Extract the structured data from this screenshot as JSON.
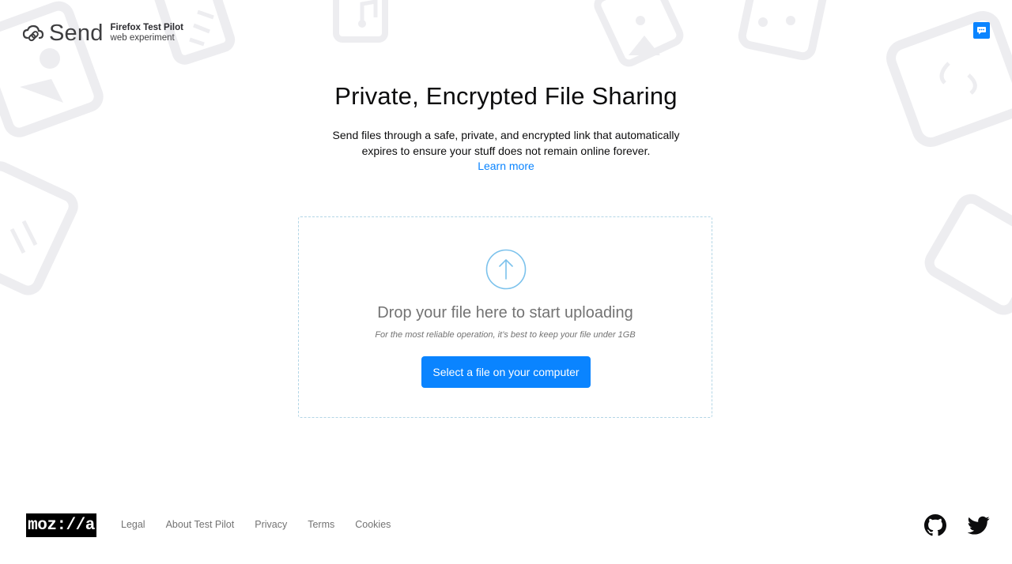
{
  "header": {
    "brand_name": "Send",
    "test_pilot_label": "Firefox Test Pilot",
    "experiment_label": "web experiment",
    "feedback_icon": "chat-bubble-icon"
  },
  "hero": {
    "title": "Private, Encrypted File Sharing",
    "description": "Send files through a safe, private, and encrypted link that automatically expires to ensure your stuff does not remain online forever.",
    "learn_more": "Learn more"
  },
  "upload": {
    "icon": "upload-arrow-icon",
    "title": "Drop your file here to start uploading",
    "hint": "For the most reliable operation, it’s best to keep your file under 1GB",
    "button_label": "Select a file on your computer"
  },
  "footer": {
    "mozilla_logo": "moz://a",
    "links": [
      {
        "label": "Legal"
      },
      {
        "label": "About Test Pilot"
      },
      {
        "label": "Privacy"
      },
      {
        "label": "Terms"
      },
      {
        "label": "Cookies"
      }
    ],
    "social_icons": [
      "github-icon",
      "twitter-icon"
    ]
  },
  "colors": {
    "accent": "#0a84ff",
    "upload_border": "#b3d6e6",
    "muted_text": "#737373",
    "background_art": "#ededf0"
  }
}
